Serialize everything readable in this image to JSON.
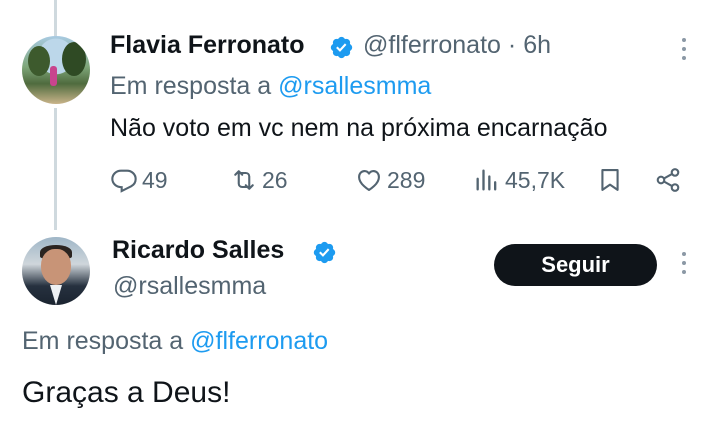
{
  "reply_tweet": {
    "author_name": "Flavia Ferronato",
    "handle": "@flferronato",
    "separator": "·",
    "time": "6h",
    "in_reply_prefix": "Em resposta a ",
    "in_reply_handle": "@rsallesmma",
    "text": "Não voto em vc nem na próxima encarnação",
    "stats": {
      "replies": "49",
      "retweets": "26",
      "likes": "289",
      "views": "45,7K"
    }
  },
  "main_tweet": {
    "author_name": "Ricardo Salles",
    "handle": "@rsallesmma",
    "follow_label": "Seguir",
    "in_reply_prefix": "Em resposta a ",
    "in_reply_handle": "@flferronato",
    "text": "Graças a Deus!"
  },
  "colors": {
    "accent": "#1d9bf0",
    "secondary_text": "#536471",
    "primary_text": "#0f1419",
    "button_bg": "#0f1419"
  },
  "icons": [
    "verified-badge-icon",
    "more-icon",
    "reply-icon",
    "retweet-icon",
    "like-icon",
    "views-icon",
    "bookmark-icon",
    "share-icon"
  ]
}
